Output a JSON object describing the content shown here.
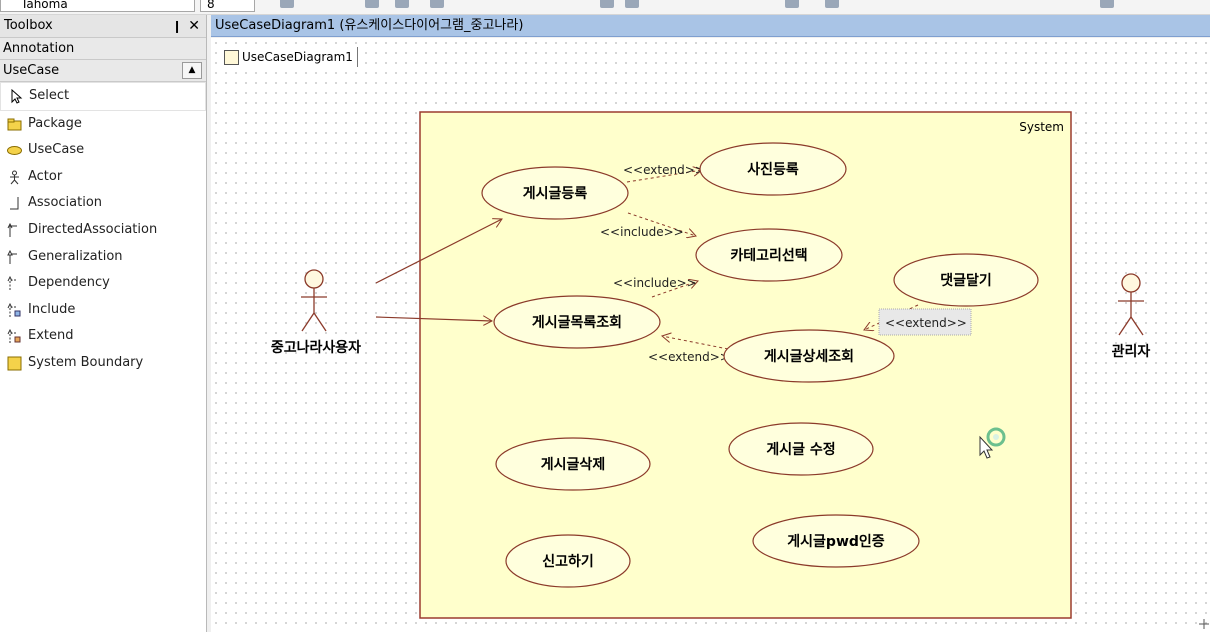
{
  "toolbar": {
    "font_name": "Tahoma",
    "font_size": "8"
  },
  "toolbox": {
    "title": "Toolbox",
    "pin_glyph": "❙",
    "close_glyph": "✕",
    "sections": {
      "annotation": "Annotation",
      "usecase": "UseCase"
    },
    "items": [
      {
        "label": "Select",
        "icon": "pointer-icon"
      },
      {
        "label": "Package",
        "icon": "folder-icon"
      },
      {
        "label": "UseCase",
        "icon": "ellipse-icon"
      },
      {
        "label": "Actor",
        "icon": "actor-icon"
      },
      {
        "label": "Association",
        "icon": "line-icon"
      },
      {
        "label": "DirectedAssociation",
        "icon": "arrow-line-icon"
      },
      {
        "label": "Generalization",
        "icon": "generalization-icon"
      },
      {
        "label": "Dependency",
        "icon": "dependency-icon"
      },
      {
        "label": "Include",
        "icon": "include-icon"
      },
      {
        "label": "Extend",
        "icon": "extend-icon"
      },
      {
        "label": "System Boundary",
        "icon": "boundary-icon"
      }
    ]
  },
  "document": {
    "tab_title": "UseCaseDiagram1 (유스케이스다이어그램_중고나라)",
    "diagram_name": "UseCaseDiagram1"
  },
  "diagram": {
    "system_label": "System",
    "actors": {
      "user": "중고나라사용자",
      "admin": "관리자"
    },
    "usecases": {
      "post_register": "게시글등록",
      "photo_register": "사진등록",
      "category_select": "카테고리선택",
      "post_list": "게시글목록조회",
      "comment": "댓글달기",
      "post_detail": "게시글상세조회",
      "post_delete": "게시글삭제",
      "post_edit": "게시글 수정",
      "post_pwd": "게시글pwd인증",
      "report": "신고하기"
    },
    "relations": {
      "extend_photo": "<<extend>>",
      "include_category1": "<<include>>",
      "include_category2": "<<include>>",
      "extend_detail": "<<extend>>",
      "extend_comment": "<<extend>>"
    }
  },
  "colors": {
    "system_fill": "#ffffcc",
    "system_border": "#9b3b2e",
    "usecase_border": "#8b3a2a",
    "tab_bg": "#a9c4e6"
  }
}
